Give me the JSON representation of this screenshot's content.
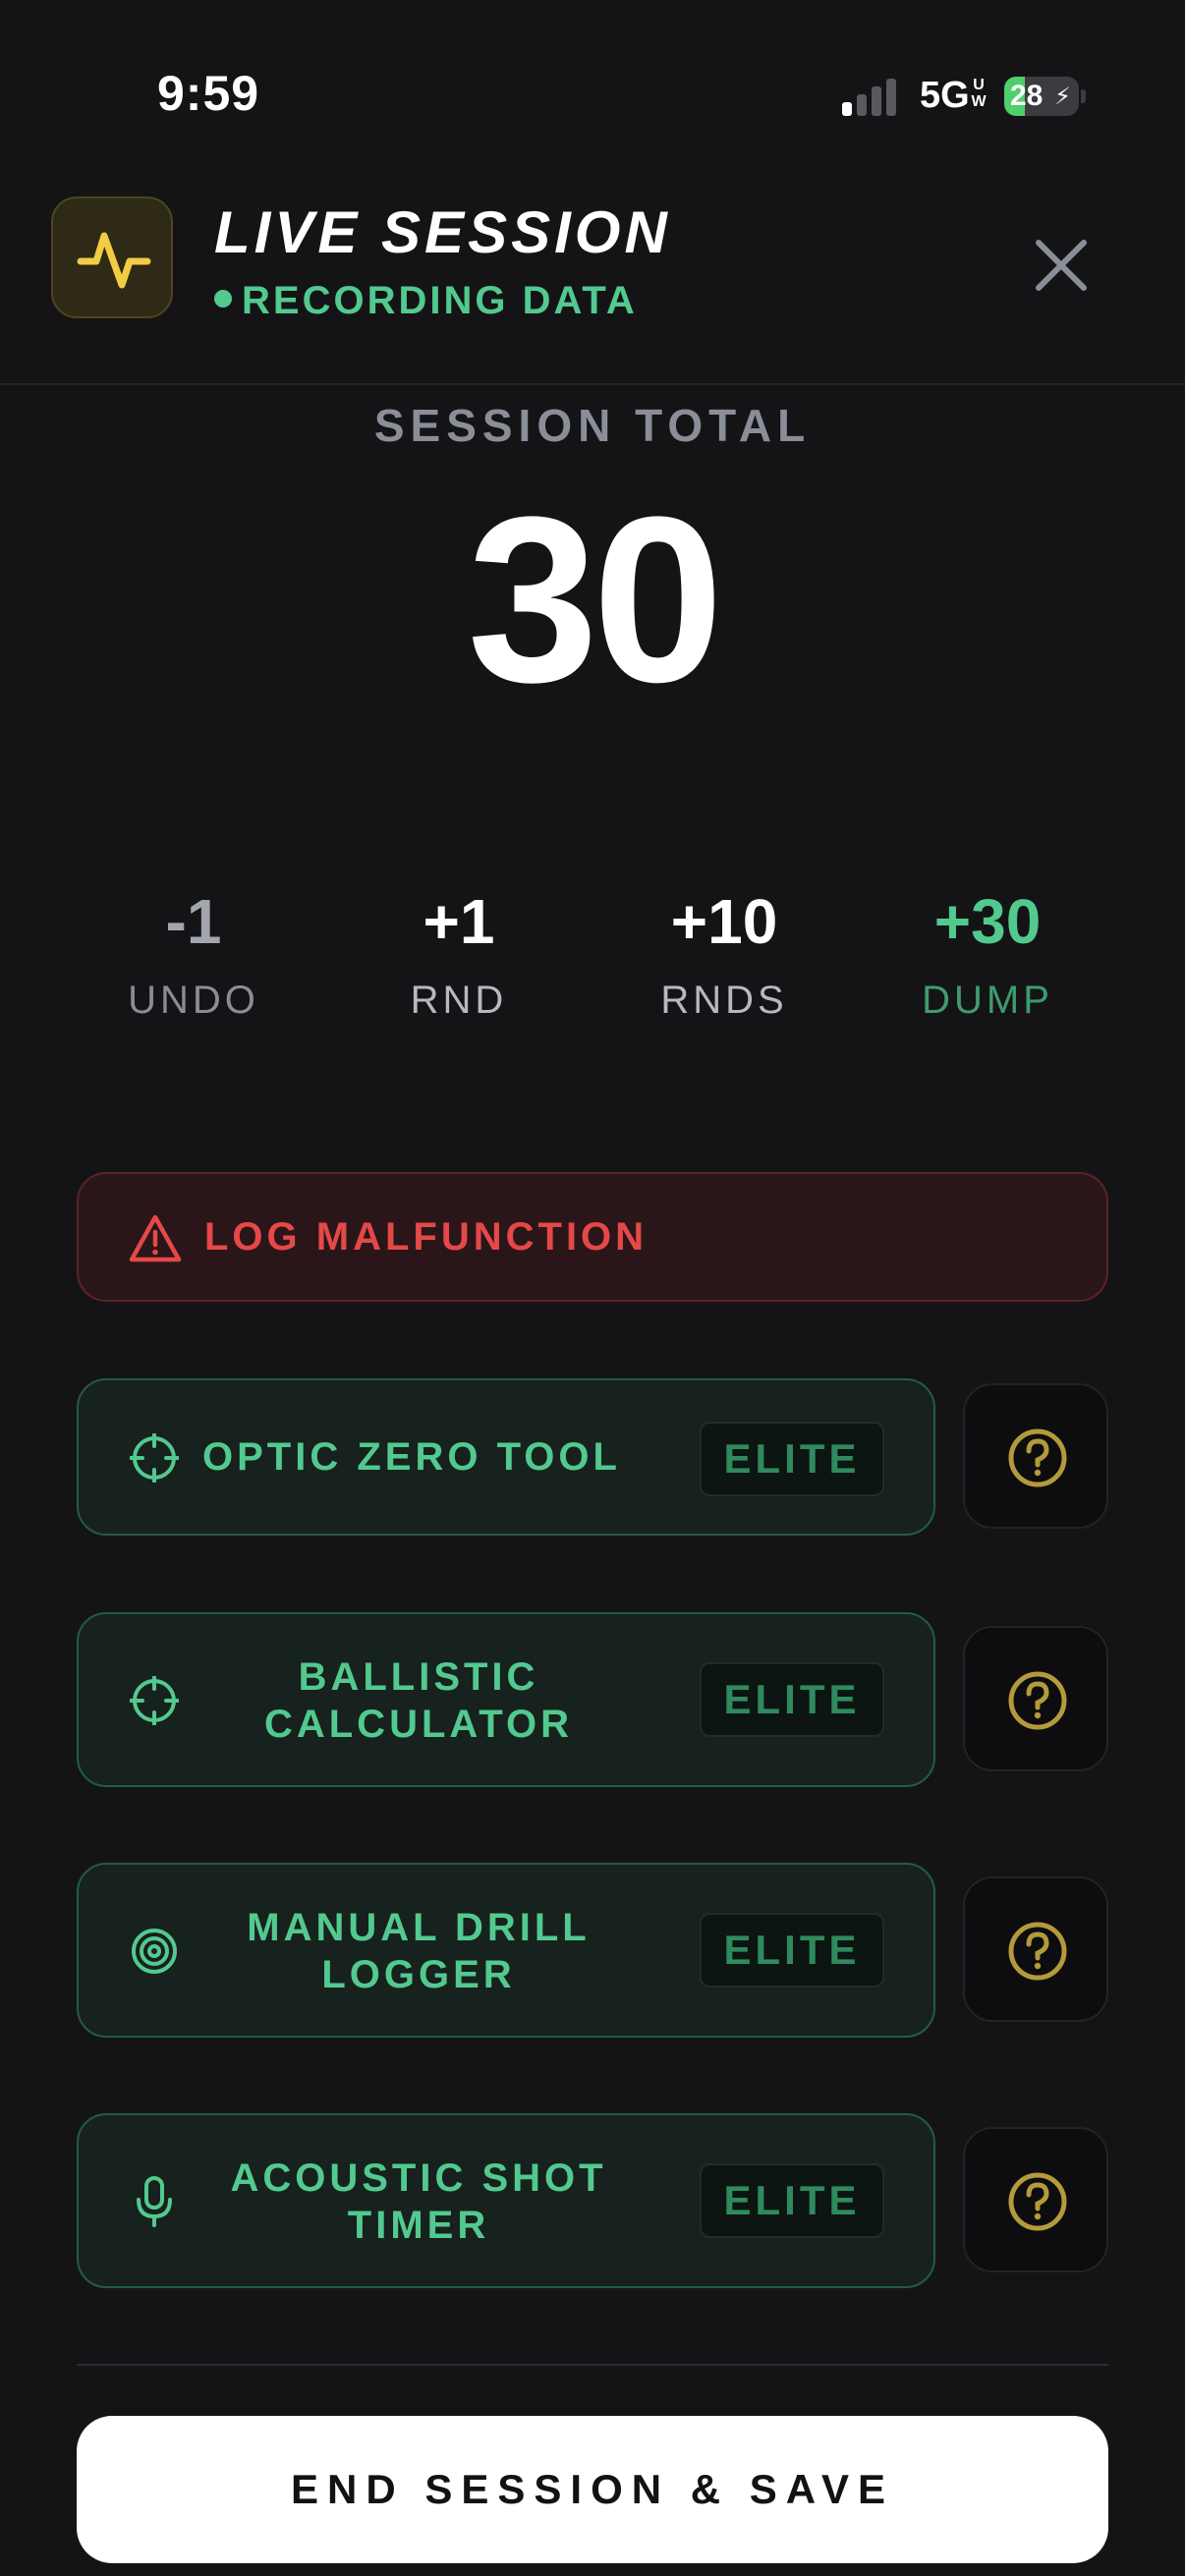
{
  "status_bar": {
    "time": "9:59",
    "network": "5G",
    "network_sup_top": "U",
    "network_sup_bottom": "W",
    "battery": "28",
    "battery_fraction": 0.28
  },
  "header": {
    "title": "LIVE SESSION",
    "subtitle": "RECORDING DATA",
    "logo_icon": "activity-pulse-icon",
    "close_icon": "close-icon"
  },
  "session": {
    "label": "SESSION TOTAL",
    "total": "30"
  },
  "counters": [
    {
      "value": "-1",
      "label": "UNDO"
    },
    {
      "value": "+1",
      "label": "RND"
    },
    {
      "value": "+10",
      "label": "RNDS"
    },
    {
      "value": "+30",
      "label": "DUMP"
    }
  ],
  "malfunction": {
    "label": "LOG MALFUNCTION",
    "icon": "warning-triangle-icon"
  },
  "tools": [
    {
      "line1": "OPTIC ZERO TOOL",
      "line2": "",
      "badge": "ELITE",
      "icon": "crosshair-icon"
    },
    {
      "line1": "BALLISTIC",
      "line2": "CALCULATOR",
      "badge": "ELITE",
      "icon": "crosshair-icon"
    },
    {
      "line1": "MANUAL DRILL",
      "line2": "LOGGER",
      "badge": "ELITE",
      "icon": "target-icon"
    },
    {
      "line1": "ACOUSTIC SHOT",
      "line2": "TIMER",
      "badge": "ELITE",
      "icon": "microphone-icon"
    }
  ],
  "footer": {
    "end_button": "END SESSION & SAVE"
  },
  "colors": {
    "background": "#141416",
    "accent_green": "#52c98f",
    "accent_yellow": "#f2cc45",
    "danger_red": "#e54848",
    "help_gold": "#b59a3c"
  }
}
